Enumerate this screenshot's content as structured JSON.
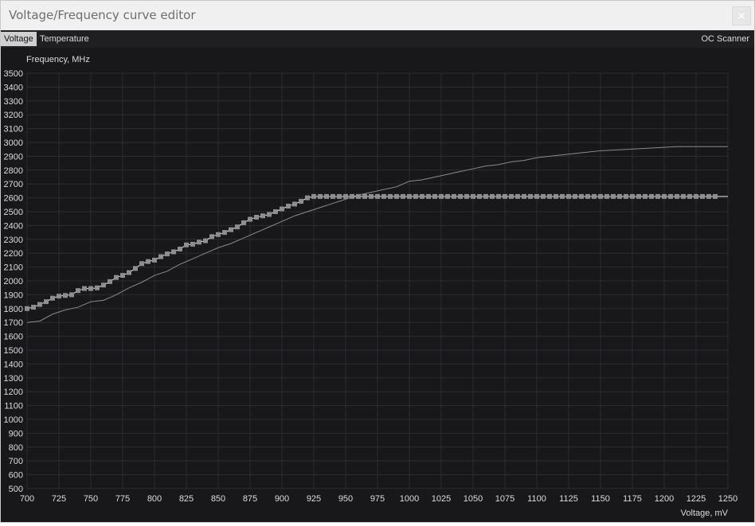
{
  "window": {
    "title": "Voltage/Frequency curve editor",
    "close_symbol": "✕"
  },
  "tabs": {
    "voltage": "Voltage",
    "temperature": "Temperature",
    "scanner": "OC Scanner"
  },
  "colors": {
    "background": "#18181b",
    "grid": "#2c2c30",
    "curve": "#e8e8e8",
    "reference": "#8a8a8a",
    "points": "#8e8e8e",
    "text": "#dcdcdc"
  },
  "chart_data": {
    "type": "line",
    "xlabel": "Voltage, mV",
    "ylabel": "Frequency, MHz",
    "xlim": [
      700,
      1250
    ],
    "ylim": [
      500,
      3500
    ],
    "x_ticks": [
      700,
      725,
      750,
      775,
      800,
      825,
      850,
      875,
      900,
      925,
      950,
      975,
      1000,
      1025,
      1050,
      1075,
      1100,
      1125,
      1150,
      1175,
      1200,
      1225,
      1250
    ],
    "y_ticks": [
      500,
      600,
      700,
      800,
      900,
      1000,
      1100,
      1200,
      1300,
      1400,
      1500,
      1600,
      1700,
      1800,
      1900,
      2000,
      2100,
      2200,
      2300,
      2400,
      2500,
      2600,
      2700,
      2800,
      2900,
      3000,
      3100,
      3200,
      3300,
      3400,
      3500
    ],
    "grid": true,
    "series": [
      {
        "role": "vf-curve",
        "points": [
          [
            700,
            1800
          ],
          [
            705,
            1810
          ],
          [
            710,
            1830
          ],
          [
            715,
            1850
          ],
          [
            720,
            1875
          ],
          [
            725,
            1890
          ],
          [
            730,
            1895
          ],
          [
            735,
            1900
          ],
          [
            740,
            1930
          ],
          [
            745,
            1945
          ],
          [
            750,
            1945
          ],
          [
            755,
            1950
          ],
          [
            760,
            1970
          ],
          [
            765,
            1995
          ],
          [
            770,
            2025
          ],
          [
            775,
            2040
          ],
          [
            780,
            2060
          ],
          [
            785,
            2090
          ],
          [
            790,
            2125
          ],
          [
            795,
            2140
          ],
          [
            800,
            2150
          ],
          [
            805,
            2175
          ],
          [
            810,
            2195
          ],
          [
            815,
            2210
          ],
          [
            820,
            2230
          ],
          [
            825,
            2260
          ],
          [
            830,
            2265
          ],
          [
            835,
            2280
          ],
          [
            840,
            2290
          ],
          [
            845,
            2320
          ],
          [
            850,
            2335
          ],
          [
            855,
            2350
          ],
          [
            860,
            2370
          ],
          [
            865,
            2390
          ],
          [
            870,
            2420
          ],
          [
            875,
            2445
          ],
          [
            880,
            2460
          ],
          [
            885,
            2470
          ],
          [
            890,
            2480
          ],
          [
            895,
            2500
          ],
          [
            900,
            2520
          ],
          [
            905,
            2540
          ],
          [
            910,
            2555
          ],
          [
            915,
            2575
          ],
          [
            920,
            2600
          ],
          [
            925,
            2610
          ],
          [
            930,
            2610
          ],
          [
            935,
            2610
          ],
          [
            940,
            2610
          ],
          [
            945,
            2610
          ],
          [
            950,
            2610
          ],
          [
            955,
            2610
          ],
          [
            960,
            2610
          ],
          [
            965,
            2610
          ],
          [
            970,
            2610
          ],
          [
            975,
            2610
          ],
          [
            980,
            2610
          ],
          [
            985,
            2610
          ],
          [
            990,
            2610
          ],
          [
            995,
            2610
          ],
          [
            1000,
            2610
          ],
          [
            1005,
            2610
          ],
          [
            1010,
            2610
          ],
          [
            1015,
            2610
          ],
          [
            1020,
            2610
          ],
          [
            1025,
            2610
          ],
          [
            1030,
            2610
          ],
          [
            1035,
            2610
          ],
          [
            1040,
            2610
          ],
          [
            1045,
            2610
          ],
          [
            1050,
            2610
          ],
          [
            1055,
            2610
          ],
          [
            1060,
            2610
          ],
          [
            1065,
            2610
          ],
          [
            1070,
            2610
          ],
          [
            1075,
            2610
          ],
          [
            1080,
            2610
          ],
          [
            1085,
            2610
          ],
          [
            1090,
            2610
          ],
          [
            1095,
            2610
          ],
          [
            1100,
            2610
          ],
          [
            1105,
            2610
          ],
          [
            1110,
            2610
          ],
          [
            1115,
            2610
          ],
          [
            1120,
            2610
          ],
          [
            1125,
            2610
          ],
          [
            1130,
            2610
          ],
          [
            1135,
            2610
          ],
          [
            1140,
            2610
          ],
          [
            1145,
            2610
          ],
          [
            1150,
            2610
          ],
          [
            1155,
            2610
          ],
          [
            1160,
            2610
          ],
          [
            1165,
            2610
          ],
          [
            1170,
            2610
          ],
          [
            1175,
            2610
          ],
          [
            1180,
            2610
          ],
          [
            1185,
            2610
          ],
          [
            1190,
            2610
          ],
          [
            1195,
            2610
          ],
          [
            1200,
            2610
          ],
          [
            1205,
            2610
          ],
          [
            1210,
            2610
          ],
          [
            1215,
            2610
          ],
          [
            1220,
            2610
          ],
          [
            1225,
            2610
          ],
          [
            1230,
            2610
          ],
          [
            1235,
            2610
          ],
          [
            1240,
            2610
          ],
          [
            1250,
            2610
          ]
        ]
      },
      {
        "role": "default-curve",
        "points": [
          [
            700,
            1700
          ],
          [
            710,
            1710
          ],
          [
            720,
            1760
          ],
          [
            730,
            1790
          ],
          [
            740,
            1810
          ],
          [
            750,
            1850
          ],
          [
            760,
            1860
          ],
          [
            770,
            1900
          ],
          [
            780,
            1950
          ],
          [
            790,
            1990
          ],
          [
            800,
            2040
          ],
          [
            810,
            2070
          ],
          [
            820,
            2120
          ],
          [
            830,
            2160
          ],
          [
            840,
            2200
          ],
          [
            850,
            2240
          ],
          [
            860,
            2270
          ],
          [
            870,
            2310
          ],
          [
            880,
            2350
          ],
          [
            890,
            2390
          ],
          [
            900,
            2430
          ],
          [
            910,
            2470
          ],
          [
            920,
            2500
          ],
          [
            930,
            2530
          ],
          [
            940,
            2560
          ],
          [
            950,
            2590
          ],
          [
            960,
            2620
          ],
          [
            970,
            2640
          ],
          [
            980,
            2660
          ],
          [
            990,
            2680
          ],
          [
            1000,
            2720
          ],
          [
            1010,
            2730
          ],
          [
            1020,
            2750
          ],
          [
            1030,
            2770
          ],
          [
            1040,
            2790
          ],
          [
            1050,
            2810
          ],
          [
            1060,
            2830
          ],
          [
            1070,
            2840
          ],
          [
            1080,
            2860
          ],
          [
            1090,
            2870
          ],
          [
            1100,
            2890
          ],
          [
            1110,
            2900
          ],
          [
            1120,
            2910
          ],
          [
            1130,
            2920
          ],
          [
            1140,
            2930
          ],
          [
            1150,
            2940
          ],
          [
            1160,
            2945
          ],
          [
            1170,
            2950
          ],
          [
            1180,
            2955
          ],
          [
            1190,
            2960
          ],
          [
            1200,
            2965
          ],
          [
            1210,
            2970
          ],
          [
            1220,
            2970
          ],
          [
            1230,
            2970
          ],
          [
            1240,
            2970
          ],
          [
            1250,
            2970
          ]
        ]
      }
    ]
  }
}
